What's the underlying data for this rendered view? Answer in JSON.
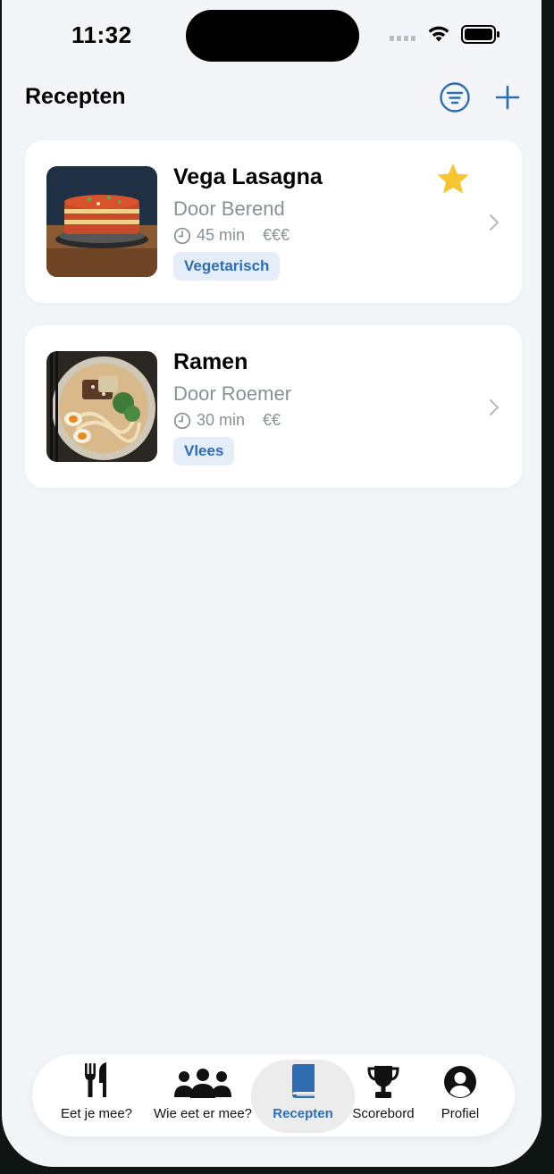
{
  "status": {
    "time": "11:32"
  },
  "header": {
    "title": "Recepten"
  },
  "recipes": [
    {
      "title": "Vega Lasagna",
      "author": "Door Berend",
      "time": "45 min",
      "price": "€€€",
      "tag": "Vegetarisch",
      "favorite": true
    },
    {
      "title": "Ramen",
      "author": "Door Roemer",
      "time": "30 min",
      "price": "€€",
      "tag": "Vlees",
      "favorite": false
    }
  ],
  "tabs": [
    {
      "label": "Eet je mee?",
      "icon": "fork-knife-icon"
    },
    {
      "label": "Wie eet er mee?",
      "icon": "people-icon"
    },
    {
      "label": "Recepten",
      "icon": "book-icon",
      "active": true
    },
    {
      "label": "Scorebord",
      "icon": "trophy-icon"
    },
    {
      "label": "Profiel",
      "icon": "person-circle-icon"
    }
  ],
  "colors": {
    "accent": "#2f6db2",
    "tag_bg": "#e4edf8",
    "star": "#f7c531",
    "background": "#f3f5f9"
  }
}
